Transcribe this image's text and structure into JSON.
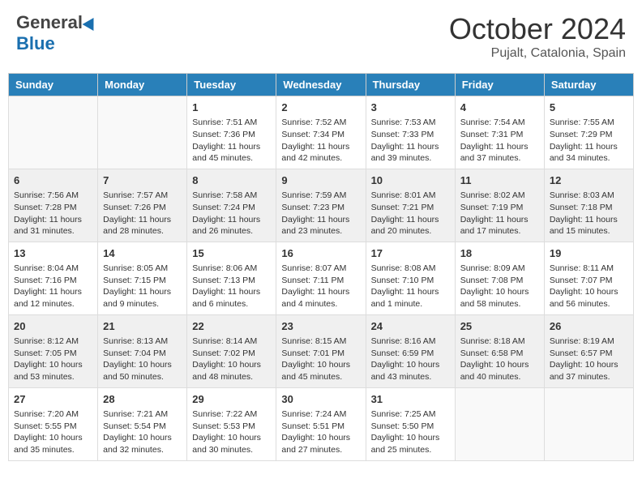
{
  "header": {
    "logo_general": "General",
    "logo_blue": "Blue",
    "month_title": "October 2024",
    "location": "Pujalt, Catalonia, Spain"
  },
  "days_of_week": [
    "Sunday",
    "Monday",
    "Tuesday",
    "Wednesday",
    "Thursday",
    "Friday",
    "Saturday"
  ],
  "weeks": [
    {
      "shaded": false,
      "days": [
        {
          "num": "",
          "info": ""
        },
        {
          "num": "",
          "info": ""
        },
        {
          "num": "1",
          "info": "Sunrise: 7:51 AM\nSunset: 7:36 PM\nDaylight: 11 hours and 45 minutes."
        },
        {
          "num": "2",
          "info": "Sunrise: 7:52 AM\nSunset: 7:34 PM\nDaylight: 11 hours and 42 minutes."
        },
        {
          "num": "3",
          "info": "Sunrise: 7:53 AM\nSunset: 7:33 PM\nDaylight: 11 hours and 39 minutes."
        },
        {
          "num": "4",
          "info": "Sunrise: 7:54 AM\nSunset: 7:31 PM\nDaylight: 11 hours and 37 minutes."
        },
        {
          "num": "5",
          "info": "Sunrise: 7:55 AM\nSunset: 7:29 PM\nDaylight: 11 hours and 34 minutes."
        }
      ]
    },
    {
      "shaded": true,
      "days": [
        {
          "num": "6",
          "info": "Sunrise: 7:56 AM\nSunset: 7:28 PM\nDaylight: 11 hours and 31 minutes."
        },
        {
          "num": "7",
          "info": "Sunrise: 7:57 AM\nSunset: 7:26 PM\nDaylight: 11 hours and 28 minutes."
        },
        {
          "num": "8",
          "info": "Sunrise: 7:58 AM\nSunset: 7:24 PM\nDaylight: 11 hours and 26 minutes."
        },
        {
          "num": "9",
          "info": "Sunrise: 7:59 AM\nSunset: 7:23 PM\nDaylight: 11 hours and 23 minutes."
        },
        {
          "num": "10",
          "info": "Sunrise: 8:01 AM\nSunset: 7:21 PM\nDaylight: 11 hours and 20 minutes."
        },
        {
          "num": "11",
          "info": "Sunrise: 8:02 AM\nSunset: 7:19 PM\nDaylight: 11 hours and 17 minutes."
        },
        {
          "num": "12",
          "info": "Sunrise: 8:03 AM\nSunset: 7:18 PM\nDaylight: 11 hours and 15 minutes."
        }
      ]
    },
    {
      "shaded": false,
      "days": [
        {
          "num": "13",
          "info": "Sunrise: 8:04 AM\nSunset: 7:16 PM\nDaylight: 11 hours and 12 minutes."
        },
        {
          "num": "14",
          "info": "Sunrise: 8:05 AM\nSunset: 7:15 PM\nDaylight: 11 hours and 9 minutes."
        },
        {
          "num": "15",
          "info": "Sunrise: 8:06 AM\nSunset: 7:13 PM\nDaylight: 11 hours and 6 minutes."
        },
        {
          "num": "16",
          "info": "Sunrise: 8:07 AM\nSunset: 7:11 PM\nDaylight: 11 hours and 4 minutes."
        },
        {
          "num": "17",
          "info": "Sunrise: 8:08 AM\nSunset: 7:10 PM\nDaylight: 11 hours and 1 minute."
        },
        {
          "num": "18",
          "info": "Sunrise: 8:09 AM\nSunset: 7:08 PM\nDaylight: 10 hours and 58 minutes."
        },
        {
          "num": "19",
          "info": "Sunrise: 8:11 AM\nSunset: 7:07 PM\nDaylight: 10 hours and 56 minutes."
        }
      ]
    },
    {
      "shaded": true,
      "days": [
        {
          "num": "20",
          "info": "Sunrise: 8:12 AM\nSunset: 7:05 PM\nDaylight: 10 hours and 53 minutes."
        },
        {
          "num": "21",
          "info": "Sunrise: 8:13 AM\nSunset: 7:04 PM\nDaylight: 10 hours and 50 minutes."
        },
        {
          "num": "22",
          "info": "Sunrise: 8:14 AM\nSunset: 7:02 PM\nDaylight: 10 hours and 48 minutes."
        },
        {
          "num": "23",
          "info": "Sunrise: 8:15 AM\nSunset: 7:01 PM\nDaylight: 10 hours and 45 minutes."
        },
        {
          "num": "24",
          "info": "Sunrise: 8:16 AM\nSunset: 6:59 PM\nDaylight: 10 hours and 43 minutes."
        },
        {
          "num": "25",
          "info": "Sunrise: 8:18 AM\nSunset: 6:58 PM\nDaylight: 10 hours and 40 minutes."
        },
        {
          "num": "26",
          "info": "Sunrise: 8:19 AM\nSunset: 6:57 PM\nDaylight: 10 hours and 37 minutes."
        }
      ]
    },
    {
      "shaded": false,
      "days": [
        {
          "num": "27",
          "info": "Sunrise: 7:20 AM\nSunset: 5:55 PM\nDaylight: 10 hours and 35 minutes."
        },
        {
          "num": "28",
          "info": "Sunrise: 7:21 AM\nSunset: 5:54 PM\nDaylight: 10 hours and 32 minutes."
        },
        {
          "num": "29",
          "info": "Sunrise: 7:22 AM\nSunset: 5:53 PM\nDaylight: 10 hours and 30 minutes."
        },
        {
          "num": "30",
          "info": "Sunrise: 7:24 AM\nSunset: 5:51 PM\nDaylight: 10 hours and 27 minutes."
        },
        {
          "num": "31",
          "info": "Sunrise: 7:25 AM\nSunset: 5:50 PM\nDaylight: 10 hours and 25 minutes."
        },
        {
          "num": "",
          "info": ""
        },
        {
          "num": "",
          "info": ""
        }
      ]
    }
  ]
}
